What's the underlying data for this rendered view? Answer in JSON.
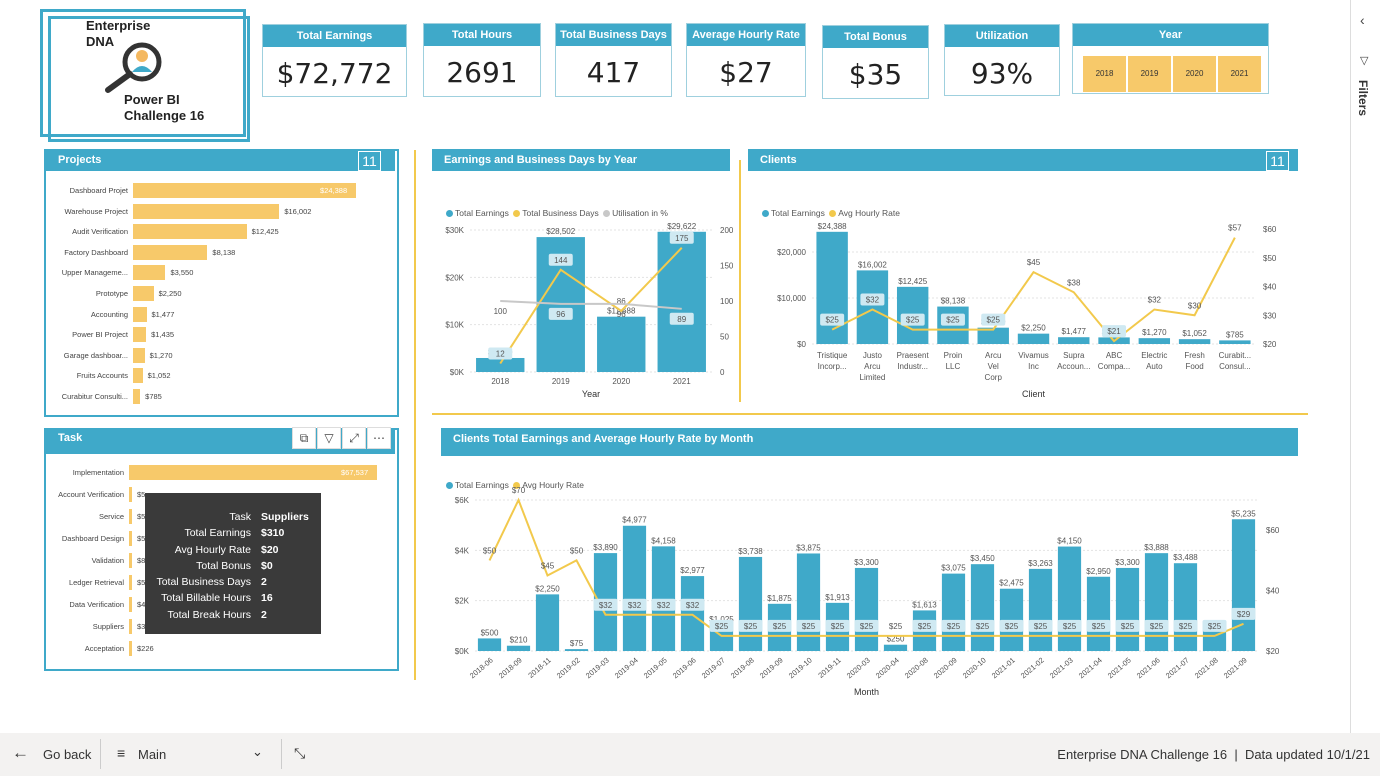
{
  "logo": {
    "line1": "Enterprise",
    "line2": "DNA",
    "line3": "Power BI",
    "line4": "Challenge 16"
  },
  "kpis": [
    {
      "label": "Total Earnings",
      "value": "$72,772"
    },
    {
      "label": "Total Hours",
      "value": "2691"
    },
    {
      "label": "Total Business Days",
      "value": "417"
    },
    {
      "label": "Average Hourly Rate",
      "value": "$27"
    },
    {
      "label": "Total Bonus",
      "value": "$35"
    },
    {
      "label": "Utilization",
      "value": "93%"
    }
  ],
  "year_slicer": {
    "title": "Year",
    "options": [
      "2018",
      "2019",
      "2020",
      "2021"
    ]
  },
  "projects": {
    "title": "Projects",
    "count": "11",
    "items": [
      {
        "label": "Dashboard Projet",
        "value": 24388,
        "display": "$24,388"
      },
      {
        "label": "Warehouse Project",
        "value": 16002,
        "display": "$16,002"
      },
      {
        "label": "Audit Verification",
        "value": 12425,
        "display": "$12,425"
      },
      {
        "label": "Factory Dashboard",
        "value": 8138,
        "display": "$8,138"
      },
      {
        "label": "Upper Manageme...",
        "value": 3550,
        "display": "$3,550"
      },
      {
        "label": "Prototype",
        "value": 2250,
        "display": "$2,250"
      },
      {
        "label": "Accounting",
        "value": 1477,
        "display": "$1,477"
      },
      {
        "label": "Power BI Project",
        "value": 1435,
        "display": "$1,435"
      },
      {
        "label": "Garage dashboar...",
        "value": 1270,
        "display": "$1,270"
      },
      {
        "label": "Fruits Accounts",
        "value": 1052,
        "display": "$1,052"
      },
      {
        "label": "Curabitur Consulti...",
        "value": 785,
        "display": "$785"
      }
    ]
  },
  "task": {
    "title": "Task",
    "header_icons": [
      "copy-icon",
      "filter-icon",
      "focus-mode-icon",
      "more-options-icon"
    ],
    "items": [
      {
        "label": "Implementation",
        "value": 67537,
        "display": "$67,537"
      },
      {
        "label": "Account Verification",
        "value": 600,
        "display": "$5"
      },
      {
        "label": "Service",
        "value": 600,
        "display": "$5"
      },
      {
        "label": "Dashboard Design",
        "value": 600,
        "display": "$5"
      },
      {
        "label": "Validation",
        "value": 600,
        "display": "$8"
      },
      {
        "label": "Ledger Retrieval",
        "value": 600,
        "display": "$5"
      },
      {
        "label": "Data Verification",
        "value": 500,
        "display": "$4"
      },
      {
        "label": "Suppliers",
        "value": 310,
        "display": "$310"
      },
      {
        "label": "Acceptation",
        "value": 226,
        "display": "$226"
      }
    ],
    "tooltip": [
      {
        "k": "Task",
        "v": "Suppliers"
      },
      {
        "k": "Total Earnings",
        "v": "$310"
      },
      {
        "k": "Avg Hourly Rate",
        "v": "$20"
      },
      {
        "k": "Total Bonus",
        "v": "$0"
      },
      {
        "k": "Total Business Days",
        "v": "2"
      },
      {
        "k": "Total Billable Hours",
        "v": "16"
      },
      {
        "k": "Total Break Hours",
        "v": "2"
      }
    ]
  },
  "colors": {
    "accent": "#3fa9c9",
    "gold": "#f7c96a",
    "line_gold": "#f2c94c",
    "gray": "#c8c8c8",
    "tooltip_bg": "#3a3a3a"
  },
  "chart_data": [
    {
      "type": "bar+line",
      "title": "Earnings and Business Days by Year",
      "xlabel": "Year",
      "legend": [
        "Total Earnings",
        "Total Business Days",
        "Utilisation in %"
      ],
      "legend_position": "top-left",
      "categories": [
        "2018",
        "2019",
        "2020",
        "2021"
      ],
      "y_left": [
        0,
        30000
      ],
      "y_left_ticks": [
        {
          "v": 0,
          "label": "$0K"
        },
        {
          "v": 10000,
          "label": "$10K"
        },
        {
          "v": 20000,
          "label": "$20K"
        },
        {
          "v": 30000,
          "label": "$30K"
        }
      ],
      "y_right": [
        0,
        200
      ],
      "y_right_ticks": [
        {
          "v": 0,
          "label": "0"
        },
        {
          "v": 50,
          "label": "50"
        },
        {
          "v": 100,
          "label": "100"
        },
        {
          "v": 150,
          "label": "150"
        },
        {
          "v": 200,
          "label": "200"
        }
      ],
      "bars": {
        "name": "Total Earnings",
        "values": [
          2960,
          28502,
          11688,
          29622
        ],
        "labels": [
          "$2,960",
          "$28,502",
          "$11,688",
          "$29,622"
        ]
      },
      "lines": [
        {
          "name": "Total Business Days",
          "color": "#f2c94c",
          "values": [
            12,
            144,
            86,
            175
          ],
          "labels": [
            "12",
            "144",
            "86",
            "175"
          ]
        },
        {
          "name": "Utilisation in %",
          "color": "#c8c8c8",
          "values": [
            100,
            96,
            96,
            89
          ],
          "labels": [
            "100",
            "96",
            "96",
            "89"
          ]
        }
      ],
      "grid": true
    },
    {
      "type": "bar+line",
      "title": "Clients",
      "count": "11",
      "xlabel": "Client",
      "legend": [
        "Total Earnings",
        "Avg Hourly Rate"
      ],
      "legend_position": "top-left",
      "categories": [
        "Tristique Incorp...",
        "Justo Arcu Limited",
        "Praesent Industr...",
        "Proin LLC",
        "Arcu Vel Corp",
        "Vivamus Inc",
        "Supra Accoun...",
        "ABC Compa...",
        "Electric Auto",
        "Fresh Food",
        "Curabit... Consul..."
      ],
      "y_left": [
        0,
        25000
      ],
      "y_left_ticks": [
        {
          "v": 0,
          "label": "$0"
        },
        {
          "v": 10000,
          "label": "$10,000"
        },
        {
          "v": 20000,
          "label": "$20,000"
        }
      ],
      "y_right": [
        20,
        60
      ],
      "y_right_ticks": [
        {
          "v": 20,
          "label": "$20"
        },
        {
          "v": 30,
          "label": "$30"
        },
        {
          "v": 40,
          "label": "$40"
        },
        {
          "v": 50,
          "label": "$50"
        },
        {
          "v": 60,
          "label": "$60"
        }
      ],
      "bars": {
        "name": "Total Earnings",
        "values": [
          24388,
          16002,
          12425,
          8138,
          3550,
          2250,
          1477,
          1435,
          1270,
          1052,
          785
        ],
        "labels": [
          "$24,388",
          "$16,002",
          "$12,425",
          "$8,138",
          "$3,550",
          "$2,250",
          "$1,477",
          "$1,435",
          "$1,270",
          "$1,052",
          "$785"
        ]
      },
      "lines": [
        {
          "name": "Avg Hourly Rate",
          "color": "#f2c94c",
          "values": [
            25,
            32,
            25,
            25,
            25,
            45,
            38,
            21,
            32,
            30,
            57
          ],
          "labels": [
            "$25",
            "$32",
            "$25",
            "$25",
            "$25",
            "$45",
            "$38",
            "$21",
            "$32",
            "$30",
            "$57"
          ]
        }
      ],
      "grid": true
    },
    {
      "type": "bar+line",
      "title": "Clients Total Earnings and Average Hourly Rate by Month",
      "xlabel": "Month",
      "legend": [
        "Total Earnings",
        "Avg Hourly Rate"
      ],
      "legend_position": "top-left",
      "categories": [
        "2018-06",
        "2018-09",
        "2018-11",
        "2019-02",
        "2019-03",
        "2019-04",
        "2019-05",
        "2019-06",
        "2019-07",
        "2019-08",
        "2019-09",
        "2019-10",
        "2019-11",
        "2020-03",
        "2020-04",
        "2020-08",
        "2020-09",
        "2020-10",
        "2021-01",
        "2021-02",
        "2021-03",
        "2021-04",
        "2021-05",
        "2021-06",
        "2021-07",
        "2021-08",
        "2021-09"
      ],
      "y_left": [
        0,
        6000
      ],
      "y_left_ticks": [
        {
          "v": 0,
          "label": "$0K"
        },
        {
          "v": 2000,
          "label": "$2K"
        },
        {
          "v": 4000,
          "label": "$4K"
        },
        {
          "v": 6000,
          "label": "$6K"
        }
      ],
      "y_right": [
        20,
        70
      ],
      "y_right_ticks": [
        {
          "v": 20,
          "label": "$20"
        },
        {
          "v": 40,
          "label": "$40"
        },
        {
          "v": 60,
          "label": "$60"
        }
      ],
      "bars": {
        "name": "Total Earnings",
        "values": [
          500,
          210,
          2250,
          75,
          3890,
          4977,
          4158,
          2977,
          1025,
          3738,
          1875,
          3875,
          1913,
          3300,
          250,
          1613,
          3075,
          3450,
          2475,
          3263,
          4150,
          2950,
          3300,
          3888,
          3488,
          875,
          5235
        ],
        "labels": [
          "$500",
          "$210",
          "$2,250",
          "$75",
          "$3,890",
          "$4,977",
          "$4,158",
          "$2,977",
          "$1,025",
          "$3,738",
          "$1,875",
          "$3,875",
          "$1,913",
          "$3,300",
          "$250",
          "$1,613",
          "$3,075",
          "$3,450",
          "$2,475",
          "$3,263",
          "$4,150",
          "$2,950",
          "$3,300",
          "$3,888",
          "$3,488",
          "$875",
          "$5,235"
        ]
      },
      "lines": [
        {
          "name": "Avg Hourly Rate",
          "color": "#f2c94c",
          "values": [
            50,
            70,
            45,
            50,
            32,
            32,
            32,
            32,
            25,
            25,
            25,
            25,
            25,
            25,
            25,
            25,
            25,
            25,
            25,
            25,
            25,
            25,
            25,
            25,
            25,
            25,
            29
          ],
          "labels": [
            "$50",
            "$70",
            "$45",
            "$50",
            "$32",
            "$32",
            "$32",
            "$32",
            "$25",
            "$25",
            "$25",
            "$25",
            "$25",
            "$25",
            "$25",
            "$25",
            "$25",
            "$25",
            "$25",
            "$25",
            "$25",
            "$25",
            "$25",
            "$25",
            "$25",
            "$25",
            "$29"
          ]
        }
      ],
      "grid": true
    }
  ],
  "filters_pane": {
    "label": "Filters"
  },
  "bottom_bar": {
    "back": "Go back",
    "page": "Main",
    "status": "Enterprise DNA Challenge 16",
    "updated": "Data updated 10/1/21"
  }
}
